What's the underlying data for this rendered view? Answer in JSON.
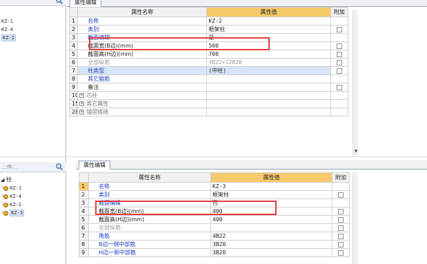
{
  "top": {
    "tree": [
      {
        "label": "KZ-1",
        "selected": false
      },
      {
        "label": "KZ-4",
        "selected": false
      },
      {
        "label": "KZ-2",
        "selected": true
      }
    ],
    "tab_label": "属性编辑",
    "header": {
      "name": "属性名称",
      "value": "属性值",
      "extra": "附加"
    },
    "rows": [
      {
        "num": "1",
        "name": "名称",
        "value": "KZ-2",
        "style": "blue",
        "checkbox": false
      },
      {
        "num": "2",
        "name": "类别",
        "value": "框架柱",
        "style": "blue",
        "checkbox": true
      },
      {
        "num": "3",
        "name": "截面编辑",
        "value": "是",
        "style": "blue",
        "checkbox": false
      },
      {
        "num": "4",
        "name": "截面宽(B边)(mm)",
        "value": "500",
        "style": "normal",
        "checkbox": true
      },
      {
        "num": "5",
        "name": "截面高(H边)(mm)",
        "value": "700",
        "style": "normal",
        "checkbox": true
      },
      {
        "num": "6",
        "name": "全部纵筋",
        "value": "4B22+12B20",
        "style": "gray",
        "checkbox": true
      },
      {
        "num": "7",
        "name": "柱类型",
        "value": "(中柱)",
        "style": "blue",
        "checkbox": true,
        "highlight": true
      },
      {
        "num": "8",
        "name": "其它箍筋",
        "value": "",
        "style": "blue",
        "checkbox": false
      },
      {
        "num": "9",
        "name": "备注",
        "value": "",
        "style": "normal",
        "checkbox": true
      },
      {
        "num": "10",
        "name": "芯柱",
        "value": "",
        "style": "group",
        "checkbox": false
      },
      {
        "num": "15",
        "name": "其它属性",
        "value": "",
        "style": "group",
        "checkbox": false
      },
      {
        "num": "28",
        "name": "锚固搭接",
        "value": "",
        "style": "group",
        "checkbox": false
      }
    ]
  },
  "bottom": {
    "search_placeholder": "…件…",
    "tree_root": "柱",
    "tree": [
      {
        "label": "KZ-1",
        "selected": false
      },
      {
        "label": "KZ-4",
        "selected": false
      },
      {
        "label": "KZ-2",
        "selected": false
      },
      {
        "label": "KZ-3",
        "selected": true
      }
    ],
    "tab_label": "属性编辑",
    "header": {
      "name": "属性名称",
      "value": "属性值",
      "extra": "附加"
    },
    "rows": [
      {
        "num": "1",
        "name": "名称",
        "value": "KZ-3",
        "style": "blue",
        "checkbox": false,
        "current": true
      },
      {
        "num": "2",
        "name": "类别",
        "value": "框架柱",
        "style": "blue",
        "checkbox": true
      },
      {
        "num": "3",
        "name": "截面编辑",
        "value": "否",
        "style": "blue",
        "checkbox": false
      },
      {
        "num": "4",
        "name": "截面宽(B边)(mm)",
        "value": "400",
        "style": "normal",
        "checkbox": true
      },
      {
        "num": "5",
        "name": "截面高(H边)(mm)",
        "value": "400",
        "style": "normal",
        "checkbox": true
      },
      {
        "num": "6",
        "name": "全部纵筋",
        "value": "",
        "style": "gray",
        "checkbox": true
      },
      {
        "num": "7",
        "name": "角筋",
        "value": "4B22",
        "style": "blue",
        "checkbox": true
      },
      {
        "num": "8",
        "name": "B边一侧中部筋",
        "value": "3B20",
        "style": "blue",
        "checkbox": true
      },
      {
        "num": "9",
        "name": "H边一侧中部筋",
        "value": "3B20",
        "style": "blue",
        "checkbox": true
      }
    ]
  },
  "colors": {
    "highlight_box": "#e53a3a",
    "value_header": "#f6c96a",
    "blue_label": "#1f3fc4"
  }
}
